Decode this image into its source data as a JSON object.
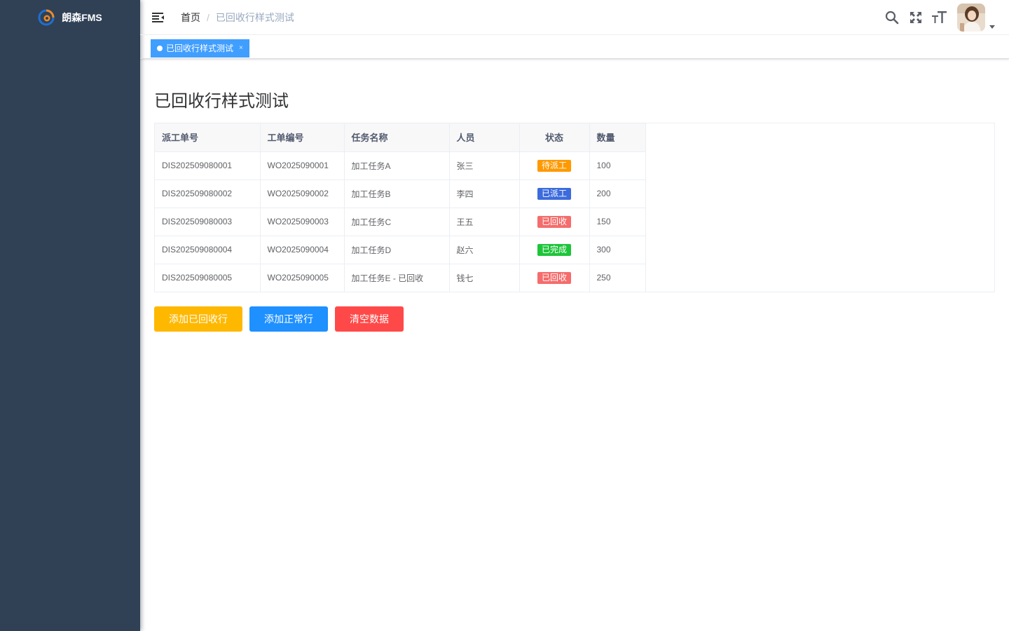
{
  "app": {
    "title": "朗森FMS"
  },
  "breadcrumb": {
    "home": "首页",
    "separator": "/",
    "current": "已回收行样式测试"
  },
  "tags": [
    {
      "label": "已回收行样式测试",
      "close": "×"
    }
  ],
  "page": {
    "title": "已回收行样式测试"
  },
  "table": {
    "headers": {
      "dispatch_no": "派工单号",
      "work_order_no": "工单编号",
      "task_name": "任务名称",
      "person": "人员",
      "status": "状态",
      "quantity": "数量"
    },
    "rows": [
      {
        "dispatch_no": "DIS202509080001",
        "work_order_no": "WO2025090001",
        "task_name": "加工任务A",
        "person": "张三",
        "status": "待派工",
        "status_color": "#ff9900",
        "quantity": "100"
      },
      {
        "dispatch_no": "DIS202509080002",
        "work_order_no": "WO2025090002",
        "task_name": "加工任务B",
        "person": "李四",
        "status": "已派工",
        "status_color": "#3c6bdc",
        "quantity": "200"
      },
      {
        "dispatch_no": "DIS202509080003",
        "work_order_no": "WO2025090003",
        "task_name": "加工任务C",
        "person": "王五",
        "status": "已回收",
        "status_color": "#f56c6c",
        "quantity": "150"
      },
      {
        "dispatch_no": "DIS202509080004",
        "work_order_no": "WO2025090004",
        "task_name": "加工任务D",
        "person": "赵六",
        "status": "已完成",
        "status_color": "#1ec53a",
        "quantity": "300"
      },
      {
        "dispatch_no": "DIS202509080005",
        "work_order_no": "WO2025090005",
        "task_name": "加工任务E - 已回收",
        "person": "钱七",
        "status": "已回收",
        "status_color": "#f56c6c",
        "quantity": "250"
      }
    ]
  },
  "buttons": {
    "add_recycled": {
      "label": "添加已回收行",
      "color": "#ffb800"
    },
    "add_normal": {
      "label": "添加正常行",
      "color": "#1e90ff"
    },
    "clear": {
      "label": "清空数据",
      "color": "#ff4949"
    }
  },
  "icons": {
    "hamburger": "hamburger-icon",
    "search": "search-icon",
    "fullscreen": "fullscreen-icon",
    "font_size": "font-size-icon",
    "avatar": "avatar",
    "dropdown": "caret-down-icon"
  },
  "colors": {
    "sidebar_bg": "#304156",
    "tag_active": "#409eff"
  }
}
